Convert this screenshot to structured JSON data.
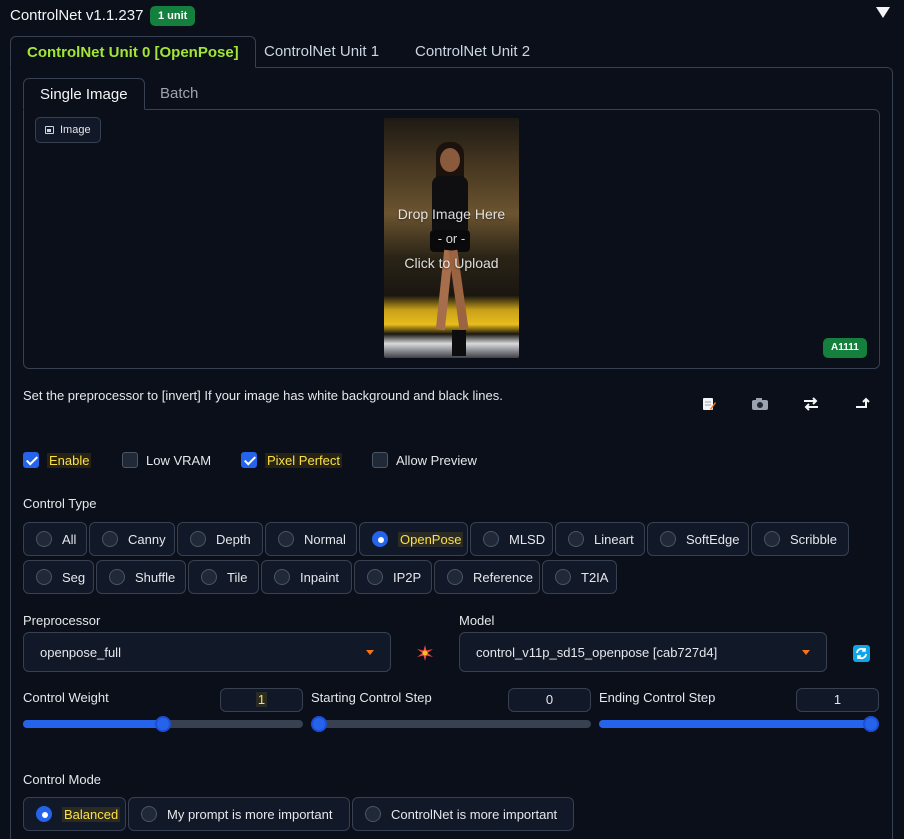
{
  "header": {
    "title": "ControlNet v1.1.237",
    "badge": "1 unit"
  },
  "unit_tabs": [
    "ControlNet Unit 0 [OpenPose]",
    "ControlNet Unit 1",
    "ControlNet Unit 2"
  ],
  "sub_tabs": [
    "Single Image",
    "Batch"
  ],
  "image_area": {
    "label": "Image",
    "drop_text": "Drop Image Here",
    "or_text": "- or -",
    "click_text": "Click to Upload",
    "badge": "A1111"
  },
  "hint": "Set the preprocessor to [invert] If your image has white background and black lines.",
  "toolbar": {
    "icons": [
      "edit-icon",
      "camera-icon",
      "swap-icon",
      "send-icon"
    ]
  },
  "checkboxes": [
    {
      "label": "Enable",
      "checked": true
    },
    {
      "label": "Low VRAM",
      "checked": false
    },
    {
      "label": "Pixel Perfect",
      "checked": true
    },
    {
      "label": "Allow Preview",
      "checked": false
    }
  ],
  "control_type": {
    "label": "Control Type",
    "options_row1": [
      "All",
      "Canny",
      "Depth",
      "Normal",
      "OpenPose",
      "MLSD",
      "Lineart",
      "SoftEdge",
      "Scribble"
    ],
    "options_row2": [
      "Seg",
      "Shuffle",
      "Tile",
      "Inpaint",
      "IP2P",
      "Reference",
      "T2IA"
    ],
    "selected": "OpenPose"
  },
  "preprocessor": {
    "label": "Preprocessor",
    "value": "openpose_full"
  },
  "model": {
    "label": "Model",
    "value": "control_v11p_sd15_openpose [cab727d4]"
  },
  "control_weight": {
    "label": "Control Weight",
    "value": "1"
  },
  "starting_step": {
    "label": "Starting Control Step",
    "value": "0"
  },
  "ending_step": {
    "label": "Ending Control Step",
    "value": "1"
  },
  "control_mode": {
    "label": "Control Mode",
    "options": [
      "Balanced",
      "My prompt is more important",
      "ControlNet is more important"
    ],
    "selected": "Balanced"
  },
  "colors": {
    "accent": "#2563eb",
    "badge_green": "#15803d",
    "active_tab": "#a3e635",
    "highlight": "#fde047"
  }
}
